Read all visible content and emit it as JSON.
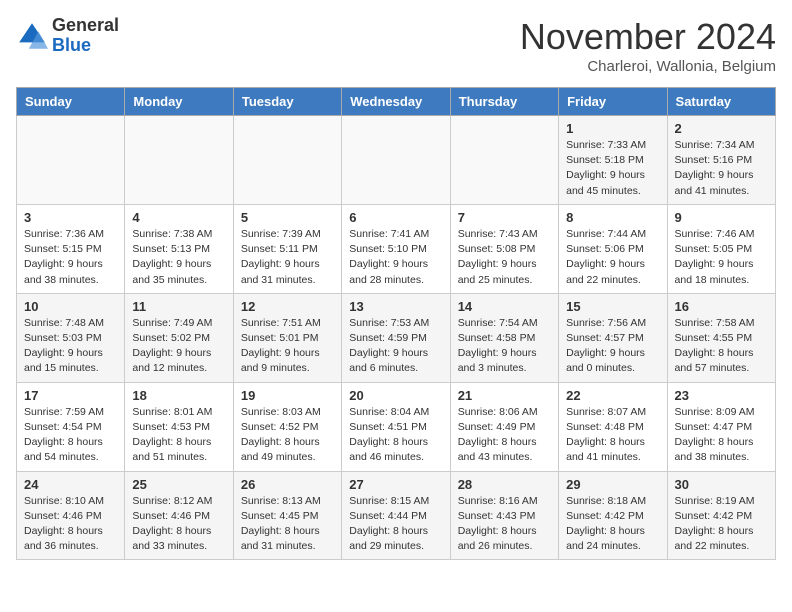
{
  "header": {
    "logo_general": "General",
    "logo_blue": "Blue",
    "month_title": "November 2024",
    "subtitle": "Charleroi, Wallonia, Belgium"
  },
  "weekdays": [
    "Sunday",
    "Monday",
    "Tuesday",
    "Wednesday",
    "Thursday",
    "Friday",
    "Saturday"
  ],
  "weeks": [
    [
      {
        "day": "",
        "info": ""
      },
      {
        "day": "",
        "info": ""
      },
      {
        "day": "",
        "info": ""
      },
      {
        "day": "",
        "info": ""
      },
      {
        "day": "",
        "info": ""
      },
      {
        "day": "1",
        "info": "Sunrise: 7:33 AM\nSunset: 5:18 PM\nDaylight: 9 hours\nand 45 minutes."
      },
      {
        "day": "2",
        "info": "Sunrise: 7:34 AM\nSunset: 5:16 PM\nDaylight: 9 hours\nand 41 minutes."
      }
    ],
    [
      {
        "day": "3",
        "info": "Sunrise: 7:36 AM\nSunset: 5:15 PM\nDaylight: 9 hours\nand 38 minutes."
      },
      {
        "day": "4",
        "info": "Sunrise: 7:38 AM\nSunset: 5:13 PM\nDaylight: 9 hours\nand 35 minutes."
      },
      {
        "day": "5",
        "info": "Sunrise: 7:39 AM\nSunset: 5:11 PM\nDaylight: 9 hours\nand 31 minutes."
      },
      {
        "day": "6",
        "info": "Sunrise: 7:41 AM\nSunset: 5:10 PM\nDaylight: 9 hours\nand 28 minutes."
      },
      {
        "day": "7",
        "info": "Sunrise: 7:43 AM\nSunset: 5:08 PM\nDaylight: 9 hours\nand 25 minutes."
      },
      {
        "day": "8",
        "info": "Sunrise: 7:44 AM\nSunset: 5:06 PM\nDaylight: 9 hours\nand 22 minutes."
      },
      {
        "day": "9",
        "info": "Sunrise: 7:46 AM\nSunset: 5:05 PM\nDaylight: 9 hours\nand 18 minutes."
      }
    ],
    [
      {
        "day": "10",
        "info": "Sunrise: 7:48 AM\nSunset: 5:03 PM\nDaylight: 9 hours\nand 15 minutes."
      },
      {
        "day": "11",
        "info": "Sunrise: 7:49 AM\nSunset: 5:02 PM\nDaylight: 9 hours\nand 12 minutes."
      },
      {
        "day": "12",
        "info": "Sunrise: 7:51 AM\nSunset: 5:01 PM\nDaylight: 9 hours\nand 9 minutes."
      },
      {
        "day": "13",
        "info": "Sunrise: 7:53 AM\nSunset: 4:59 PM\nDaylight: 9 hours\nand 6 minutes."
      },
      {
        "day": "14",
        "info": "Sunrise: 7:54 AM\nSunset: 4:58 PM\nDaylight: 9 hours\nand 3 minutes."
      },
      {
        "day": "15",
        "info": "Sunrise: 7:56 AM\nSunset: 4:57 PM\nDaylight: 9 hours\nand 0 minutes."
      },
      {
        "day": "16",
        "info": "Sunrise: 7:58 AM\nSunset: 4:55 PM\nDaylight: 8 hours\nand 57 minutes."
      }
    ],
    [
      {
        "day": "17",
        "info": "Sunrise: 7:59 AM\nSunset: 4:54 PM\nDaylight: 8 hours\nand 54 minutes."
      },
      {
        "day": "18",
        "info": "Sunrise: 8:01 AM\nSunset: 4:53 PM\nDaylight: 8 hours\nand 51 minutes."
      },
      {
        "day": "19",
        "info": "Sunrise: 8:03 AM\nSunset: 4:52 PM\nDaylight: 8 hours\nand 49 minutes."
      },
      {
        "day": "20",
        "info": "Sunrise: 8:04 AM\nSunset: 4:51 PM\nDaylight: 8 hours\nand 46 minutes."
      },
      {
        "day": "21",
        "info": "Sunrise: 8:06 AM\nSunset: 4:49 PM\nDaylight: 8 hours\nand 43 minutes."
      },
      {
        "day": "22",
        "info": "Sunrise: 8:07 AM\nSunset: 4:48 PM\nDaylight: 8 hours\nand 41 minutes."
      },
      {
        "day": "23",
        "info": "Sunrise: 8:09 AM\nSunset: 4:47 PM\nDaylight: 8 hours\nand 38 minutes."
      }
    ],
    [
      {
        "day": "24",
        "info": "Sunrise: 8:10 AM\nSunset: 4:46 PM\nDaylight: 8 hours\nand 36 minutes."
      },
      {
        "day": "25",
        "info": "Sunrise: 8:12 AM\nSunset: 4:46 PM\nDaylight: 8 hours\nand 33 minutes."
      },
      {
        "day": "26",
        "info": "Sunrise: 8:13 AM\nSunset: 4:45 PM\nDaylight: 8 hours\nand 31 minutes."
      },
      {
        "day": "27",
        "info": "Sunrise: 8:15 AM\nSunset: 4:44 PM\nDaylight: 8 hours\nand 29 minutes."
      },
      {
        "day": "28",
        "info": "Sunrise: 8:16 AM\nSunset: 4:43 PM\nDaylight: 8 hours\nand 26 minutes."
      },
      {
        "day": "29",
        "info": "Sunrise: 8:18 AM\nSunset: 4:42 PM\nDaylight: 8 hours\nand 24 minutes."
      },
      {
        "day": "30",
        "info": "Sunrise: 8:19 AM\nSunset: 4:42 PM\nDaylight: 8 hours\nand 22 minutes."
      }
    ]
  ]
}
